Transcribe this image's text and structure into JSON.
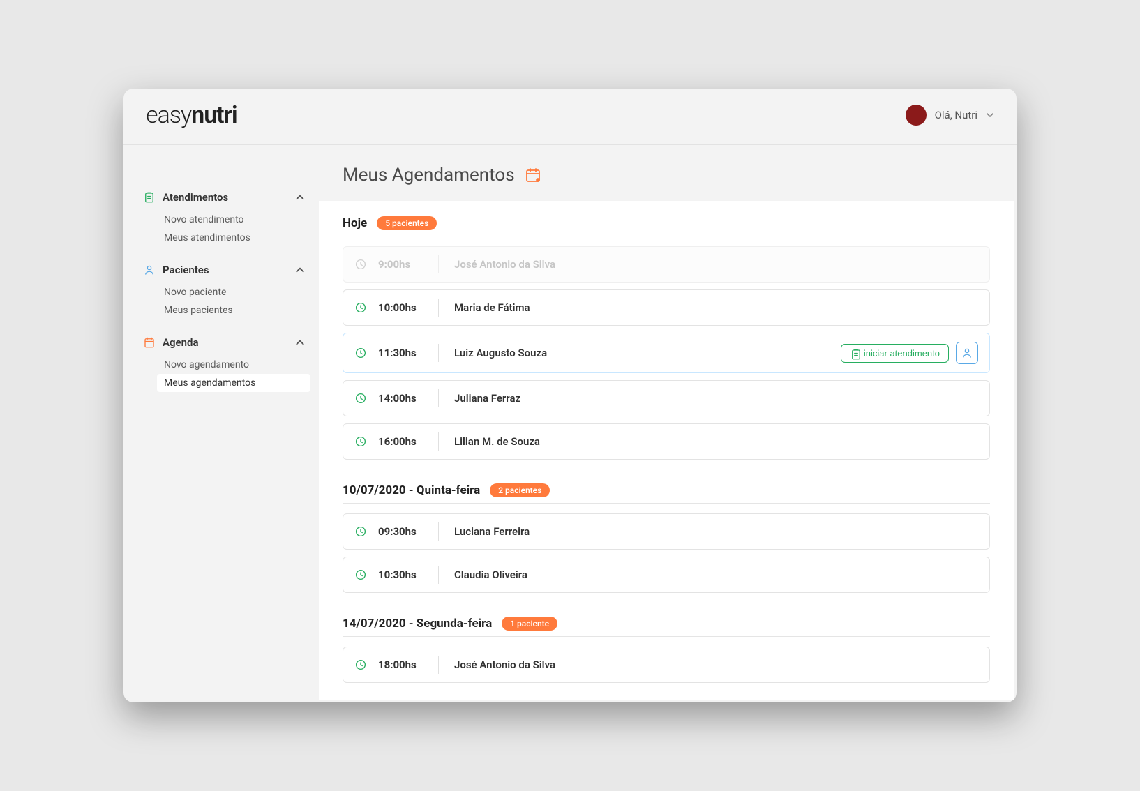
{
  "brand": {
    "prefix": "easy",
    "suffix": "nutri"
  },
  "user": {
    "greeting": "Olá, Nutri"
  },
  "sidebar": {
    "sections": [
      {
        "id": "atendimentos",
        "label": "Atendimentos",
        "icon": "clipboard-icon",
        "color": "#27ae60",
        "items": [
          {
            "label": "Novo atendimento",
            "active": false
          },
          {
            "label": "Meus atendimentos",
            "active": false
          }
        ]
      },
      {
        "id": "pacientes",
        "label": "Pacientes",
        "icon": "person-icon",
        "color": "#5aa9e6",
        "items": [
          {
            "label": "Novo paciente",
            "active": false
          },
          {
            "label": "Meus pacientes",
            "active": false
          }
        ]
      },
      {
        "id": "agenda",
        "label": "Agenda",
        "icon": "calendar-icon",
        "color": "#ff7a3c",
        "items": [
          {
            "label": "Novo agendamento",
            "active": false
          },
          {
            "label": "Meus agendamentos",
            "active": true
          }
        ]
      }
    ]
  },
  "page": {
    "title": "Meus Agendamentos"
  },
  "days": [
    {
      "title": "Hoje",
      "badge": "5 pacientes",
      "appointments": [
        {
          "time": "9:00hs",
          "name": "José Antonio da Silva",
          "past": true,
          "selected": false
        },
        {
          "time": "10:00hs",
          "name": "Maria de Fátima",
          "past": false,
          "selected": false
        },
        {
          "time": "11:30hs",
          "name": "Luiz Augusto Souza",
          "past": false,
          "selected": true,
          "start_label": "iniciar atendimento"
        },
        {
          "time": "14:00hs",
          "name": "Juliana Ferraz",
          "past": false,
          "selected": false
        },
        {
          "time": "16:00hs",
          "name": "Lilian M. de Souza",
          "past": false,
          "selected": false
        }
      ]
    },
    {
      "title": "10/07/2020 - Quinta-feira",
      "badge": "2 pacientes",
      "appointments": [
        {
          "time": "09:30hs",
          "name": "Luciana Ferreira",
          "past": false,
          "selected": false
        },
        {
          "time": "10:30hs",
          "name": "Claudia Oliveira",
          "past": false,
          "selected": false
        }
      ]
    },
    {
      "title": "14/07/2020 - Segunda-feira",
      "badge": "1 paciente",
      "appointments": [
        {
          "time": "18:00hs",
          "name": "José Antonio da Silva",
          "past": false,
          "selected": false
        }
      ]
    }
  ]
}
